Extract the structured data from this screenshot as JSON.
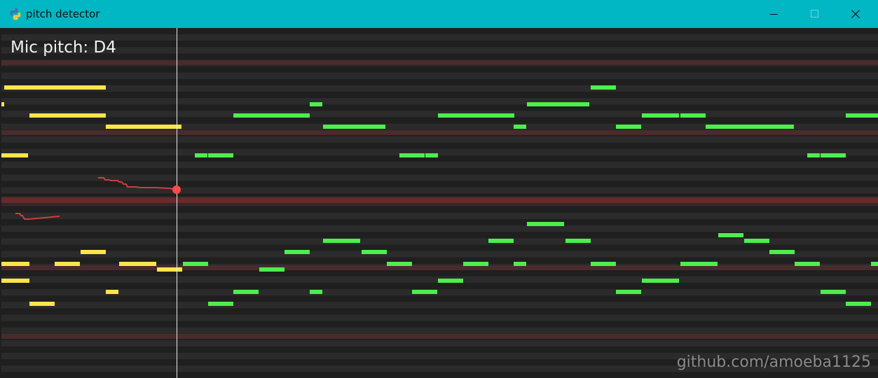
{
  "window": {
    "title": "pitch detector",
    "titlebar_color": "#00b7c3",
    "icon": "python-icon",
    "controls": {
      "minimize_icon": "minimize-icon",
      "maximize_icon": "maximize-icon",
      "close_icon": "close-icon"
    }
  },
  "overlay": {
    "mic_pitch_text": "Mic pitch: D4",
    "watermark": "github.com/amoeba1125"
  },
  "piano_roll": {
    "background": "#1f1f1f",
    "lane_dark": "#1f1f1f",
    "lane_light": "#2b2b2b",
    "c_lane_color": "#4a2b2b",
    "current_lane_color": "#6a2a2a",
    "played_note_color": "#ffe54a",
    "upcoming_note_color": "#4cef4c",
    "pitch_trace_color": "#c84040",
    "playhead_color": "#e8e8e8",
    "detected_pitch": "D4"
  }
}
